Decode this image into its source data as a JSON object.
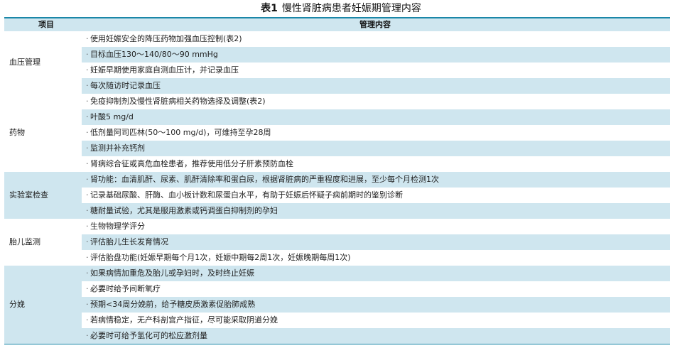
{
  "title": {
    "number": "表1",
    "text": "慢性肾脏病患者妊娠期管理内容"
  },
  "header": {
    "col1": "项目",
    "col2": "管理内容"
  },
  "bullet": "·",
  "groups": [
    {
      "label": "血压管理",
      "items": [
        "使用妊娠安全的降压药物加强血压控制(表2)",
        "目标血压130～140/80～90 mmHg",
        "妊娠早期使用家庭自测血压计，并记录血压",
        "每次随访时记录血压"
      ]
    },
    {
      "label": "药物",
      "items": [
        "免疫抑制剂及慢性肾脏病相关药物选择及调整(表2)",
        "叶酸5 mg/d",
        "低剂量阿司匹林(50～100 mg/d)，可维持至孕28周",
        "监测并补充钙剂",
        "肾病综合征或高危血栓患者，推荐使用低分子肝素预防血栓"
      ]
    },
    {
      "label": "实验室检查",
      "items": [
        "肾功能：血清肌酐、尿素、肌酐清除率和蛋白尿，根据肾脏病的严重程度和进展，至少每个月检测1次",
        "记录基础尿酸、肝酶、血小板计数和尿蛋白水平，有助于妊娠后怀疑子痫前期时的鉴别诊断",
        "糖耐量试验，尤其是服用激素或钙调蛋白抑制剂的孕妇"
      ]
    },
    {
      "label": "胎儿监测",
      "items": [
        "生物物理学评分",
        "评估胎儿生长发育情况",
        "评估胎盘功能(妊娠早期每个月1次，妊娠中期每2周1次，妊娠晚期每周1次)"
      ]
    },
    {
      "label": "分娩",
      "items": [
        "如果病情加重危及胎儿或孕妇时，及时终止妊娠",
        "必要时给予间断氧疗",
        "预期<34周分娩前，给予糖皮质激素促胎肺成熟",
        "若病情稳定，无产科剖宫产指征，尽可能采取阴道分娩",
        "必要时可给予氢化可的松应激剂量"
      ]
    }
  ]
}
